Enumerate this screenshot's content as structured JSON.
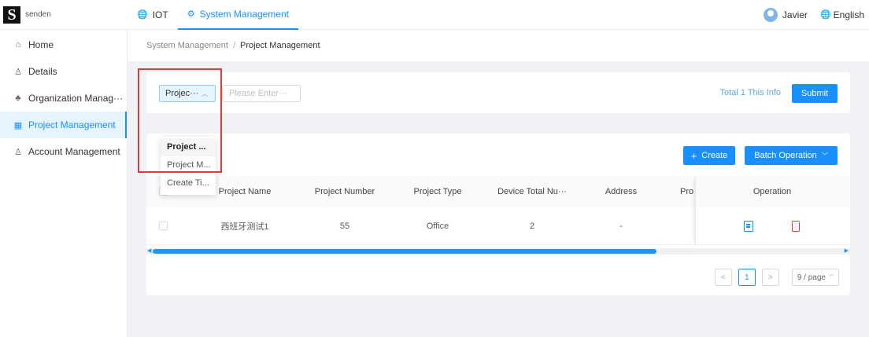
{
  "brand": {
    "letter": "S",
    "name": "senden"
  },
  "topnav": [
    {
      "icon": "globe-icon",
      "label": "IOT"
    },
    {
      "icon": "gear-icon",
      "label": "System Management"
    }
  ],
  "user": {
    "name": "Javier",
    "language": "English"
  },
  "sidebar": {
    "items": [
      {
        "icon": "home-icon",
        "label": "Home"
      },
      {
        "icon": "user-details-icon",
        "label": "Details"
      },
      {
        "icon": "org-tree-icon",
        "label": "Organization Manag···"
      },
      {
        "icon": "grid-icon",
        "label": "Project Management"
      },
      {
        "icon": "user-icon",
        "label": "Account Management"
      }
    ]
  },
  "breadcrumb": {
    "parent": "System Management",
    "separator": "/",
    "current": "Project Management"
  },
  "filter": {
    "select_label": "Projec···",
    "input_placeholder": "Please Enter···",
    "total_info": "Total 1 This Info",
    "submit_label": "Submit",
    "dropdown_options": [
      "Project ...",
      "Project M...",
      "Create Ti..."
    ]
  },
  "toolbar": {
    "create_label": "Create",
    "batch_label": "Batch Operation"
  },
  "table": {
    "columns": [
      "Project Name",
      "Project Number",
      "Project Type",
      "Device Total Nu···",
      "Address",
      "Pro",
      "Operation"
    ],
    "rows": [
      {
        "project_name": "西班牙测试1",
        "project_number": "55",
        "project_type": "Office",
        "device_total": "2",
        "address": "-"
      }
    ]
  },
  "pagination": {
    "prev": "<",
    "current_page": "1",
    "next": ">",
    "page_size": "9 / page"
  },
  "colors": {
    "primary": "#1890ff",
    "danger": "#e53935",
    "highlight_box": "#e53935"
  }
}
